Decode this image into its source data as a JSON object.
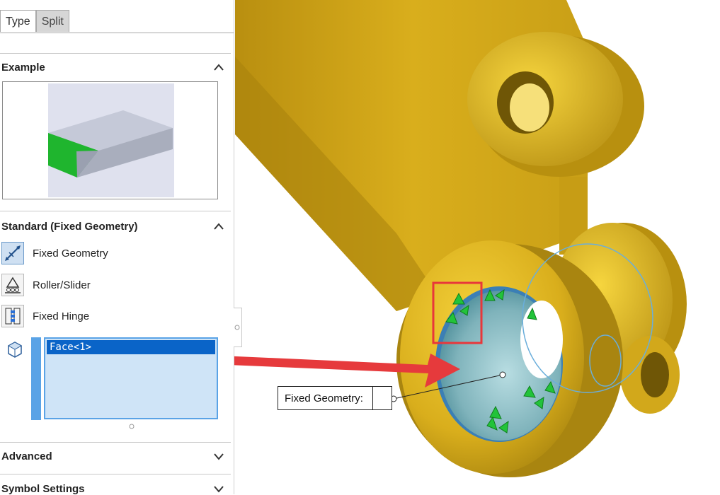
{
  "tabs": [
    {
      "label": "Type"
    },
    {
      "label": "Split"
    }
  ],
  "sections": {
    "example": {
      "title": "Example"
    },
    "standard": {
      "title": "Standard (Fixed Geometry)"
    },
    "advanced": {
      "title": "Advanced"
    },
    "symbol_settings": {
      "title": "Symbol Settings"
    }
  },
  "fixture_options": [
    {
      "label": "Fixed Geometry",
      "icon": "fixed-geometry-icon",
      "selected": true
    },
    {
      "label": "Roller/Slider",
      "icon": "roller-slider-icon",
      "selected": false
    },
    {
      "label": "Fixed Hinge",
      "icon": "fixed-hinge-icon",
      "selected": false
    }
  ],
  "selection_list": {
    "items": [
      "Face<1>"
    ],
    "icon": "face-selection-icon"
  },
  "viewport": {
    "callout_label": "Fixed Geometry:",
    "part_color": "#D9AE1C",
    "highlight_color": "#E8373A",
    "arrow_color": "#E63A3C",
    "fixture_marker_color": "#22C33A"
  }
}
